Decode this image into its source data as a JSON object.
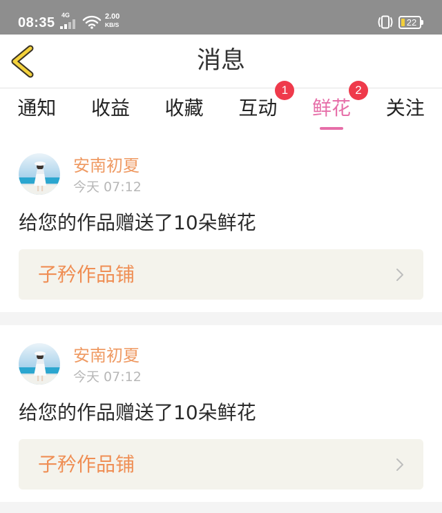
{
  "status_bar": {
    "time": "08:35",
    "network": "4G",
    "speed_value": "2.00",
    "speed_unit": "KB/S",
    "battery": "22"
  },
  "header": {
    "title": "消息"
  },
  "tabs": [
    {
      "label": "通知"
    },
    {
      "label": "收益"
    },
    {
      "label": "收藏"
    },
    {
      "label": "互动",
      "badge": "1"
    },
    {
      "label": "鲜花",
      "badge": "2",
      "active": true
    },
    {
      "label": "关注"
    }
  ],
  "messages": [
    {
      "sender": "安南初夏",
      "time": "今天 07:12",
      "text": "给您的作品赠送了10朵鲜花",
      "shop": "子矜作品铺"
    },
    {
      "sender": "安南初夏",
      "time": "今天 07:12",
      "text": "给您的作品赠送了10朵鲜花",
      "shop": "子矜作品铺"
    }
  ],
  "icons": {
    "back": "back-arrow-icon",
    "signal": "signal-icon",
    "wifi": "wifi-icon",
    "vibrate": "vibrate-icon",
    "battery": "battery-icon",
    "shop_link": "chevron-right-icon"
  },
  "colors": {
    "status_bar": "#8e8e8e",
    "accent": "#e66ea8",
    "sender_name": "#ef9a63",
    "shop_name": "#ef8e54",
    "badge": "#ef3a4b",
    "panel": "#f4f3ec"
  }
}
